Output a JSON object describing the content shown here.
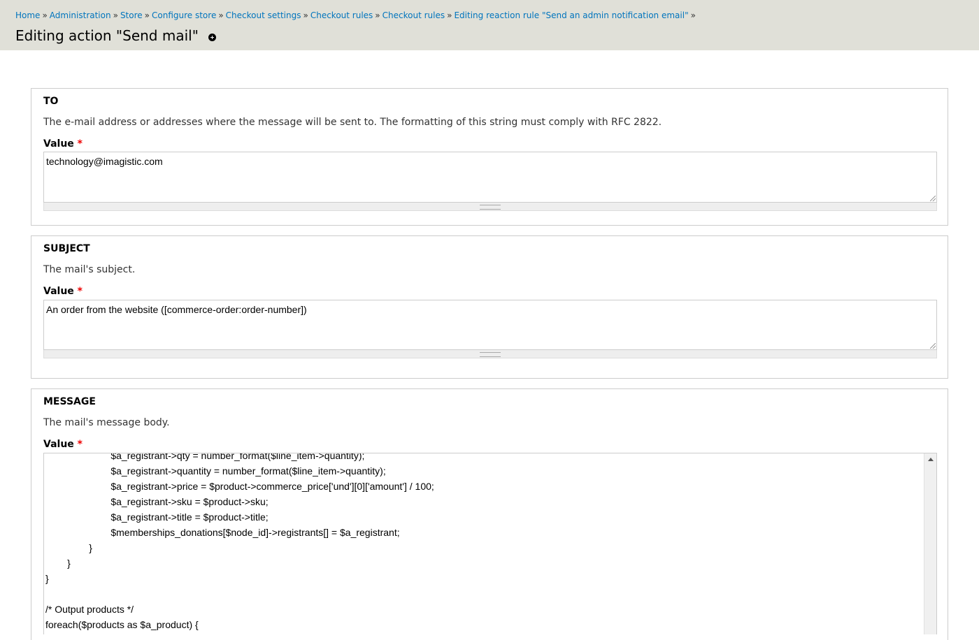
{
  "breadcrumb": [
    {
      "label": "Home"
    },
    {
      "label": "Administration"
    },
    {
      "label": "Store"
    },
    {
      "label": "Configure store"
    },
    {
      "label": "Checkout settings"
    },
    {
      "label": "Checkout rules"
    },
    {
      "label": "Checkout rules"
    },
    {
      "label": "Editing reaction rule \"Send an admin notification email\""
    }
  ],
  "breadcrumb_separator": "»",
  "page_title": "Editing action \"Send mail\"",
  "required_marker": "*",
  "to": {
    "legend": "TO",
    "description": "The e-mail address or addresses where the message will be sent to. The formatting of this string must comply with RFC 2822.",
    "value_label": "Value",
    "value": "technology@imagistic.com"
  },
  "subject": {
    "legend": "SUBJECT",
    "description": "The mail's subject.",
    "value_label": "Value",
    "value": "An order from the website ([commerce-order:order-number])"
  },
  "message": {
    "legend": "MESSAGE",
    "description": "The mail's message body.",
    "value_label": "Value",
    "lines": [
      "                        $a_registrant->qty = number_format($line_item->quantity);",
      "                        $a_registrant->quantity = number_format($line_item->quantity);",
      "                        $a_registrant->price = $product->commerce_price['und'][0]['amount'] / 100;",
      "                        $a_registrant->sku = $product->sku;",
      "                        $a_registrant->title = $product->title;",
      "                        $memberships_donations[$node_id]->registrants[] = $a_registrant;",
      "                }",
      "        }",
      "}",
      "",
      "/* Output products */",
      "foreach($products as $a_product) {"
    ]
  },
  "icons": {
    "shortcut": "add-shortcut-icon",
    "scroll_up": "scroll-up-arrow-icon"
  }
}
